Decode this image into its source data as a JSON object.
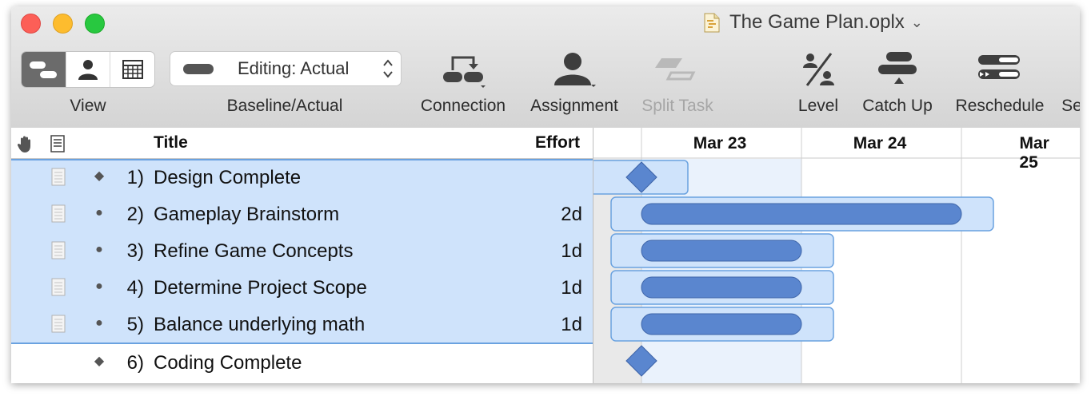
{
  "window": {
    "title": "The Game Plan.oplx"
  },
  "toolbar": {
    "view_label": "View",
    "baseline": {
      "value": "Editing: Actual",
      "label": "Baseline/Actual"
    },
    "connection_label": "Connection",
    "assignment_label": "Assignment",
    "split_task_label": "Split Task",
    "level_label": "Level",
    "catch_up_label": "Catch Up",
    "reschedule_label": "Reschedule",
    "truncated_label": "Se"
  },
  "outline": {
    "columns": {
      "title": "Title",
      "effort": "Effort"
    },
    "rows": [
      {
        "number": "1)",
        "title": "Design Complete",
        "effort": "",
        "kind": "milestone"
      },
      {
        "number": "2)",
        "title": "Gameplay Brainstorm",
        "effort": "2d",
        "kind": "task"
      },
      {
        "number": "3)",
        "title": "Refine Game Concepts",
        "effort": "1d",
        "kind": "task"
      },
      {
        "number": "4)",
        "title": "Determine Project Scope",
        "effort": "1d",
        "kind": "task"
      },
      {
        "number": "5)",
        "title": "Balance underlying math",
        "effort": "1d",
        "kind": "task"
      },
      {
        "number": "6)",
        "title": "Coding Complete",
        "effort": "",
        "kind": "milestone"
      }
    ]
  },
  "gantt": {
    "dates": [
      "Mar 23",
      "Mar 24",
      "Mar 25"
    ],
    "tasks": [
      {
        "kind": "milestone",
        "start_day": 0,
        "selected": true
      },
      {
        "kind": "task",
        "start_day": 0,
        "duration_days": 2,
        "selected": true
      },
      {
        "kind": "task",
        "start_day": 0,
        "duration_days": 1,
        "selected": true
      },
      {
        "kind": "task",
        "start_day": 0,
        "duration_days": 1,
        "selected": true
      },
      {
        "kind": "task",
        "start_day": 0,
        "duration_days": 1,
        "selected": true
      },
      {
        "kind": "milestone",
        "start_day": 0,
        "selected": false
      }
    ]
  },
  "colors": {
    "selection": "#cfe3fb",
    "selection_border": "#6aa2e0",
    "bar": "#5a86cf",
    "today_column": "#eaf2fc"
  }
}
